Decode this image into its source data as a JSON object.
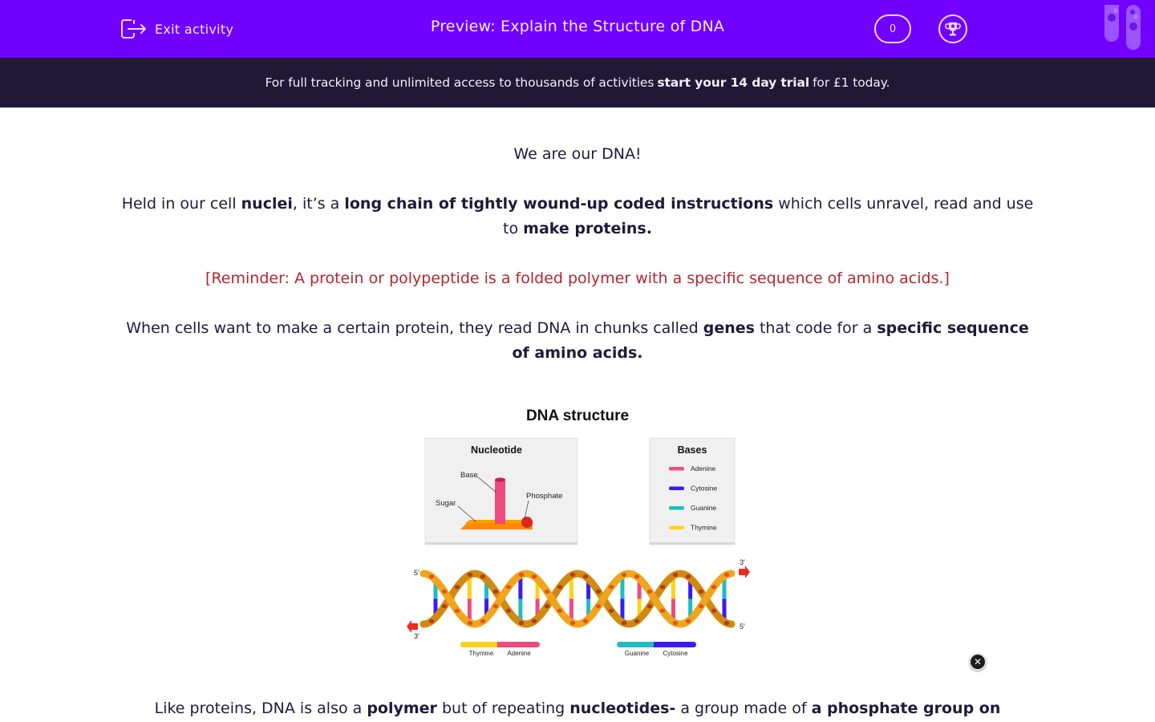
{
  "header": {
    "exit_label": "Exit activity",
    "title": "Preview: Explain the Structure of DNA",
    "score": "0",
    "brand_color": "#7100ff"
  },
  "banner": {
    "text_before": "For full tracking and unlimited access to thousands of activities",
    "cta": "start your 14 day trial",
    "text_after": "for £1 today."
  },
  "content": {
    "p1": "We are our DNA!",
    "p2": {
      "t1": "Held in our cell ",
      "b1": "nuclei",
      "t2": ", it’s a ",
      "b2": "long chain of tightly wound-up coded instructions",
      "t3": " which cells unravel, read and use to ",
      "b3": "make proteins."
    },
    "reminder": "[Reminder: A protein or polypeptide is a folded polymer with a specific sequence of amino acids.]",
    "p3": {
      "t1": "When cells want to make a certain protein, they read DNA in chunks called ",
      "b1": "genes",
      "t2": " that code for a ",
      "b2": "specific sequence of amino acids."
    },
    "p4": {
      "t1": "Like proteins, DNA is also a ",
      "b1": "polymer",
      "t2": " but of repeating ",
      "b2": "nucleotides-",
      "t3": " a group made of ",
      "b3": "a phosphate group on"
    }
  },
  "figure": {
    "title": "DNA structure",
    "nucleotide_panel": {
      "title": "Nucleotide",
      "labels": {
        "base": "Base",
        "sugar": "Sugar",
        "phosphate": "Phosphate"
      }
    },
    "bases_panel": {
      "title": "Bases",
      "items": [
        {
          "name": "Adenine",
          "color": "#ef4a7d"
        },
        {
          "name": "Cytosine",
          "color": "#3a1cf0"
        },
        {
          "name": "Guanine",
          "color": "#1fbcc0"
        },
        {
          "name": "Thymine",
          "color": "#ffd21a"
        }
      ]
    },
    "strand_labels": {
      "top_left": "5′",
      "top_right": "3′",
      "bottom_left": "3′",
      "bottom_right": "5′"
    },
    "pairs": [
      {
        "left": "Thymine",
        "right": "Adenine"
      },
      {
        "left": "Guanine",
        "right": "Cytosine"
      }
    ]
  },
  "icons": {
    "exit": "exit-door-icon",
    "trophy": "trophy-icon",
    "tubes": "test-tubes-icon",
    "close": "close-icon"
  }
}
